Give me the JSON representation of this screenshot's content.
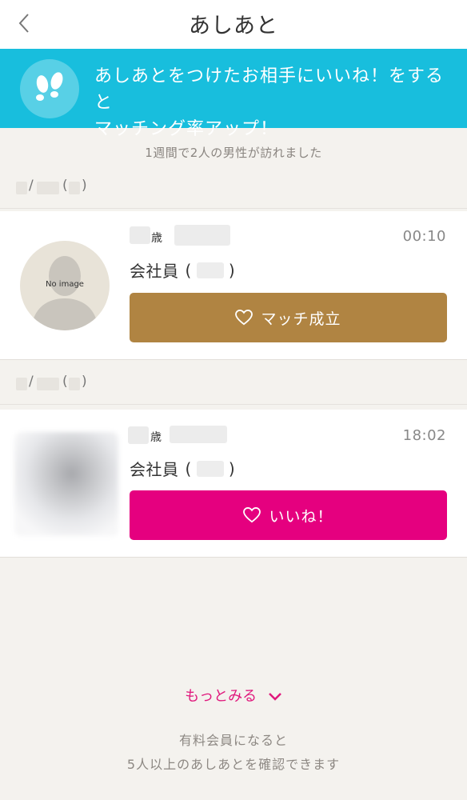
{
  "nav": {
    "title": "あしあと",
    "back_icon": "chevron-left-icon"
  },
  "banner": {
    "icon": "footprints-icon",
    "line1": "あしあとをつけたお相手にいいね！をすると",
    "line2": "マッチング率アップ！",
    "color": "#18bedd"
  },
  "summary": "1週間で2人の男性が訪れました",
  "visits": [
    {
      "date_sep": "/",
      "age_unit": "歳",
      "time": "00:10",
      "job": "会社員",
      "avatar_label": "No image",
      "button_label": "マッチ成立",
      "button_icon": "heart-outline-icon",
      "button_color": "#b08442"
    },
    {
      "date_sep": "/",
      "age_unit": "歳",
      "time": "18:02",
      "job": "会社員",
      "button_label": "いいね！",
      "button_icon": "heart-outline-icon",
      "button_color": "#e5007f"
    }
  ],
  "footer": {
    "more_label": "もっとみる",
    "more_color": "#e0197d",
    "upsell_line1": "有料会員になると",
    "upsell_line2": "5人以上のあしあとを確認できます"
  }
}
